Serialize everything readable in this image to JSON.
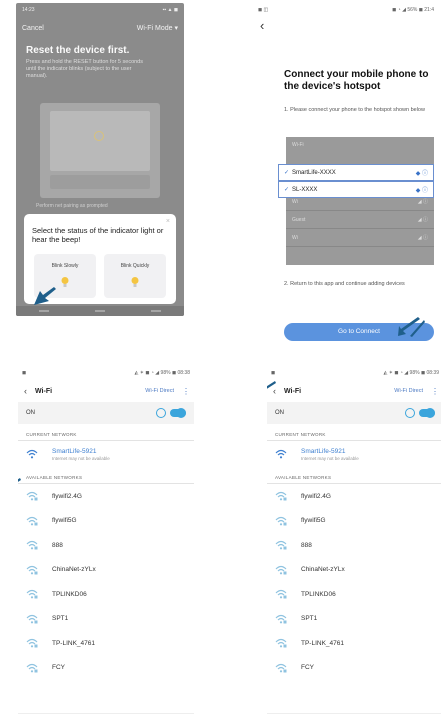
{
  "panel1": {
    "status_time": "14:23",
    "status_icons": "▪▪ ▲ ◼",
    "cancel": "Cancel",
    "mode": "Wi-Fi Mode ▾",
    "title": "Reset the device first.",
    "description": "Press and hold the RESET button for 5 seconds until the indicator blinks (subject to the user manual).",
    "hint": "Perform net pairing as prompted",
    "question": "Select the status of the indicator light or hear the beep!",
    "option_slow": "Blink Slowly",
    "option_quick": "Blink Quickly",
    "close": "×"
  },
  "panel2": {
    "status_left": "◼ ◫",
    "status_right": "◼ ◔ ◢ 56% ◼ 21:4",
    "back": "‹",
    "title": "Connect your mobile phone to the device's hotspot",
    "step1": "1. Please connect your phone to the hotspot shown below",
    "wifi_header": "Wi-Fi",
    "hotspot_1": "SmartLife-XXXX",
    "hotspot_2": "SL-XXXX",
    "blur_rows": [
      "Wi",
      "Guest",
      "Wi"
    ],
    "step2": "2. Return to this app and continue adding devices",
    "button": "Go to Connect",
    "check": "✓"
  },
  "wifi_common": {
    "title": "Wi-Fi",
    "wifi_direct": "Wi-Fi Direct",
    "more": "⋮",
    "back": "‹",
    "on": "ON",
    "current_section": "CURRENT NETWORK",
    "available_section": "AVAILABLE NETWORKS",
    "current_name": "SmartLife-5921",
    "current_sub": "Internet may not be available",
    "networks": [
      "flywifi2.4G",
      "flywifi5G",
      "888",
      "ChinaNet-zYLx",
      "TPLINKD06",
      "SPT1",
      "TP-LINK_4761",
      "FCY"
    ]
  },
  "panel3": {
    "status_left": "◼",
    "status_right": "◭ ✶ ◼ ◔ ◢ 98% ◼ 08:38"
  },
  "panel4": {
    "status_left": "◼",
    "status_right": "◭ ✶ ◼ ◔ ◢ 98% ◼ 08:39"
  },
  "colors": {
    "accent": "#3d7fd0",
    "button": "#5b93de",
    "toggle": "#3ba5dc",
    "arrow": "#1f5f8b"
  },
  "icons": [
    "pointer-arrow-icon",
    "wifi-icon",
    "bulb-icon",
    "info-icon",
    "check-icon"
  ]
}
